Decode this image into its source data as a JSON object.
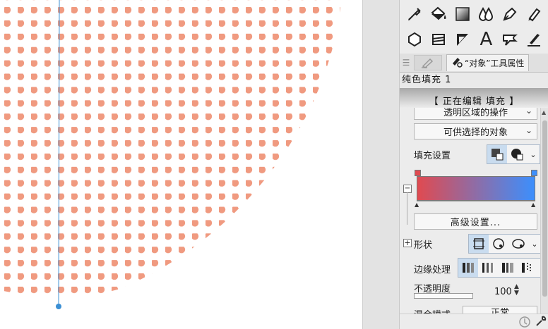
{
  "tools": {
    "row1": [
      "eyedropper-icon",
      "paint-bucket-icon",
      "gradient-icon",
      "blend-drops-icon",
      "pen-nib-icon",
      "marker-icon"
    ],
    "row2": [
      "polygon-icon",
      "frame-border-icon",
      "ruler-triangle-icon",
      "text-icon",
      "balloon-icon",
      "correction-line-icon"
    ],
    "row2_text_glyph": "A"
  },
  "tabs": {
    "menu_glyph": "☰",
    "tab2_label": "“对象”工具属性"
  },
  "layer_title": "纯色填充 1",
  "editing_banner": "【 正在编辑 填充 】",
  "props": {
    "transparent_area_select": "透明区域的操作",
    "selectable_objects_select": "可供选择的对象",
    "fill_settings_label": "填充设置",
    "gradient": {
      "start_color": "#e04a50",
      "end_color": "#3c8ffd"
    },
    "advanced_button": "高级设置...",
    "shape_label": "形状",
    "edge_label": "边缘处理",
    "opacity_label": "不透明度",
    "opacity_value": "100",
    "blend_label": "混合模式",
    "blend_value": "正常"
  },
  "colors": {
    "dot_color": "#f09a80",
    "guide_line": "#3a8fd4",
    "panel_bg": "#ececec"
  }
}
